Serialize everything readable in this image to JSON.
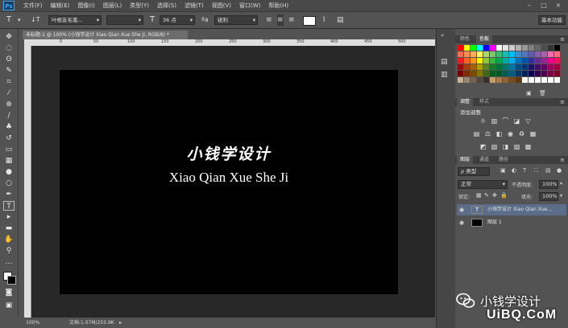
{
  "app": {
    "logo": "Ps"
  },
  "menu": [
    "文件(F)",
    "编辑(E)",
    "图像(I)",
    "图层(L)",
    "类型(Y)",
    "选择(S)",
    "滤镜(T)",
    "视图(V)",
    "窗口(W)",
    "帮助(H)"
  ],
  "options": {
    "tool_icon": "T",
    "orient_icon": "↓T",
    "font_family": "叶根友毛笔...",
    "font_style": "",
    "size_icon": "T",
    "font_size": "36 点",
    "aa_icon": "ªa",
    "aa_mode": "锐利",
    "color_hex": "#ffffff",
    "workspace": "基本功能"
  },
  "document": {
    "tab_title": "未标题-1 @ 100% (小钱学设计 Xiao Qian Xue She Ji, RGB/8) *",
    "text_cn": "小钱学设计",
    "text_en": "Xiao Qian Xue She Ji",
    "ruler_numbers": [
      "0",
      "50",
      "100",
      "150",
      "200",
      "250",
      "300",
      "350",
      "400",
      "450",
      "500"
    ]
  },
  "status": {
    "zoom": "100%",
    "doc_size": "文档:1.07M/255.9K"
  },
  "panels": {
    "color_tabs": [
      "颜色",
      "色板"
    ],
    "adjust_tabs": [
      "调整",
      "样式"
    ],
    "adjust_title": "添加调整",
    "layer_tabs": [
      "图层",
      "通道",
      "路径"
    ],
    "layer_filter": "ρ 类型",
    "blend_mode": "正常",
    "opacity_label": "不透明度:",
    "opacity_value": "100%",
    "lock_label": "锁定:",
    "fill_label": "填充:",
    "fill_value": "100%",
    "layers": [
      {
        "name": "小钱学设计  Xiao Qian Xue...",
        "type": "text",
        "thumb": "T"
      },
      {
        "name": "图层 1",
        "type": "pixel",
        "thumb": ""
      }
    ]
  },
  "watermark": {
    "text": "小钱学设计",
    "url": "UiBQ.CoM"
  },
  "colors": {
    "swatches": [
      "#ff0000",
      "#ffff00",
      "#00ff00",
      "#00ffff",
      "#0000ff",
      "#ff00ff",
      "#ffffff",
      "#e6e6e6",
      "#cccccc",
      "#b3b3b3",
      "#999999",
      "#808080",
      "#666666",
      "#4d4d4d",
      "#333333",
      "#000000",
      "#f26c4f",
      "#f68e55",
      "#fbaf5c",
      "#fff467",
      "#acd372",
      "#7dc473",
      "#3cb878",
      "#1abbb4",
      "#00bff3",
      "#438ccb",
      "#5574b9",
      "#605ca8",
      "#855fa8",
      "#a763a9",
      "#f06eaa",
      "#f26d7d",
      "#ed1c24",
      "#f26522",
      "#f7941d",
      "#fff200",
      "#8dc63f",
      "#39b54a",
      "#00a651",
      "#00a99d",
      "#00aeef",
      "#0072bc",
      "#0054a6",
      "#2e3192",
      "#662d91",
      "#92278f",
      "#ec008c",
      "#ed145b",
      "#9e0b0f",
      "#a0410d",
      "#a36209",
      "#aba000",
      "#598527",
      "#197b30",
      "#007236",
      "#00746b",
      "#0076a3",
      "#004a80",
      "#003471",
      "#1b1464",
      "#440e62",
      "#630460",
      "#9e005d",
      "#9e0039",
      "#790000",
      "#7b2e00",
      "#7d4900",
      "#827b00",
      "#406618",
      "#005e20",
      "#005826",
      "#005952",
      "#005b7f",
      "#003663",
      "#002157",
      "#0d004c",
      "#32004b",
      "#4b0049",
      "#7b0046",
      "#7a0026",
      "#c7b299",
      "#998675",
      "#736357",
      "#534741",
      "#37302a",
      "#c69c6d",
      "#a67c52",
      "#8c6239",
      "#754c24",
      "#603913",
      "#ffffff",
      "#ffffff",
      "#ffffff",
      "#ffffff",
      "#ffffff",
      "#ffffff"
    ]
  }
}
